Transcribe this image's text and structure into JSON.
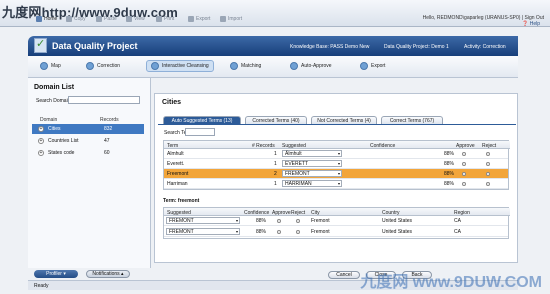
{
  "watermark": "九度网http://www.9duw.com",
  "toolbar": {
    "items": [
      "Home",
      "Copy",
      "Paste",
      "View",
      "Print",
      "Export",
      "Import"
    ],
    "user": "Hello, REDMOND\\gaparleg (URANUS-SP0) | Sign Out",
    "help": "Help"
  },
  "banner": {
    "title": "Data Quality Project",
    "knowledge_base": "Knowledge Base: PASS Demo New",
    "project": "Data Quality Project: Demo 1",
    "activity": "Activity: Correction"
  },
  "steps": [
    "Map",
    "Correction",
    "Interactive Cleansing",
    "Matching",
    "Auto-Approve",
    "Export"
  ],
  "domain_list": {
    "title": "Domain List",
    "search_label": "Search Domain:",
    "search_value": "",
    "col_domain": "Domain",
    "col_records": "Records",
    "rows": [
      {
        "name": "Cities",
        "records": "832"
      },
      {
        "name": "Countries List",
        "records": "47"
      },
      {
        "name": "States code",
        "records": "60"
      }
    ]
  },
  "main": {
    "title": "Cities",
    "tabs": [
      "Auto Suggested Terms (13)",
      "Corrected Terms (40)",
      "Not Corrected Terms (4)",
      "Correct Terms (767)"
    ],
    "search_term_label": "Search Term:",
    "search_term_value": "",
    "table_headers": [
      "Term",
      "# Records",
      "Suggested",
      "Confidence",
      "Approve",
      "Reject"
    ],
    "rows": [
      {
        "term": "Almhult",
        "records": "1",
        "suggested": "Älmhult",
        "confidence": "88%"
      },
      {
        "term": "Everett.",
        "records": "1",
        "suggested": "EVERETT",
        "confidence": "88%"
      },
      {
        "term": "Freemont",
        "records": "2",
        "suggested": "FREMONT",
        "confidence": "88%"
      },
      {
        "term": "Harriman",
        "records": "1",
        "suggested": "HARRIMAN",
        "confidence": "88%"
      }
    ],
    "term_detail_label": "Term: freemont",
    "detail_headers": [
      "Suggested",
      "Confidence",
      "Approve",
      "Reject",
      "City",
      "Country",
      "Region"
    ],
    "detail_rows": [
      {
        "suggested": "FREMONT",
        "confidence": "88%",
        "city": "Fremont",
        "country": "United States",
        "region": "CA"
      },
      {
        "suggested": "FREMONT",
        "confidence": "88%",
        "city": "Fremont",
        "country": "United States",
        "region": "CA"
      }
    ]
  },
  "footer": {
    "profiler": "Profiler ▾",
    "notifications": "Notifications ▴",
    "cancel": "Cancel",
    "close": "Close",
    "back": "Back",
    "status": "Ready"
  },
  "brand_watermark": "九度网 www.9DUW.COM"
}
